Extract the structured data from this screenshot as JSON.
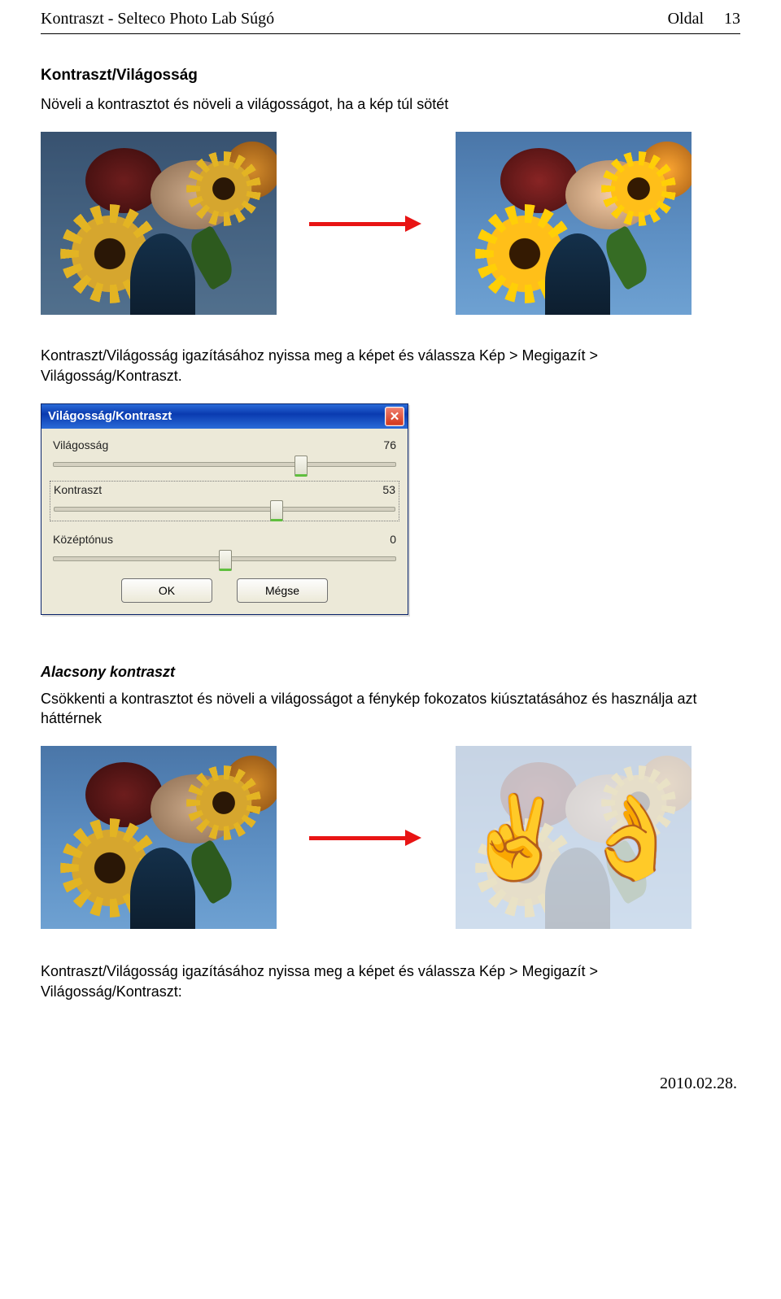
{
  "header": {
    "doc_title": "Kontraszt - Selteco Photo Lab Súgó",
    "page_label": "Oldal",
    "page_number": "13"
  },
  "section1": {
    "heading": "Kontraszt/Világosság",
    "intro": "Növeli a kontrasztot és növeli a világosságot, ha a kép túl sötét",
    "instruction": "Kontraszt/Világosság igazításához nyissa meg a képet és válassza Kép > Megigazít > Világosság/Kontraszt."
  },
  "dialog": {
    "title": "Világosság/Kontraszt",
    "close_glyph": "✕",
    "sliders": {
      "brightness": {
        "label": "Világosság",
        "value": "76",
        "percent": 72
      },
      "contrast": {
        "label": "Kontraszt",
        "value": "53",
        "percent": 65
      },
      "midtone": {
        "label": "Középtónus",
        "value": "0",
        "percent": 50
      }
    },
    "buttons": {
      "ok": "OK",
      "cancel": "Mégse"
    }
  },
  "section2": {
    "heading": "Alacsony kontraszt",
    "intro": "Csökkenti a kontrasztot és növeli a világosságot a fénykép fokozatos kiúsztatásához és használja azt háttérnek",
    "instruction": "Kontraszt/Világosság igazításához nyissa meg a képet és válassza Kép > Megigazít > Világosság/Kontraszt:"
  },
  "symbols": {
    "victory": "✌",
    "ok_hand": "👌"
  },
  "footer": {
    "date": "2010.02.28."
  }
}
